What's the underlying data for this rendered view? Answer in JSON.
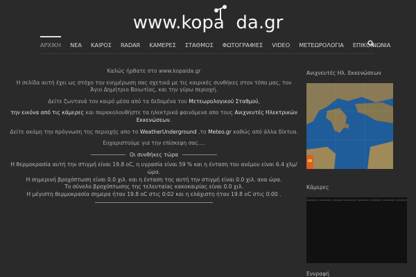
{
  "site": {
    "logo_text": "www.kopa  da.gr"
  },
  "nav": {
    "items": [
      {
        "label": "ΑΡΧΙΚΗ",
        "active": true
      },
      {
        "label": "ΝΕΑ"
      },
      {
        "label": "ΚΑΙΡΟΣ"
      },
      {
        "label": "RADAR"
      },
      {
        "label": "ΚΑΜΕΡΕΣ"
      },
      {
        "label": "ΣΤΑΘΜΟΣ"
      },
      {
        "label": "ΦΩΤΟΓΡΑΦΙΕΣ"
      },
      {
        "label": "VIDEO"
      },
      {
        "label": "ΜΕΤΕΩΡΟΛΟΓΙΑ"
      },
      {
        "label": "ΕΠΙΚΟΙΝΩΝΙΑ"
      }
    ]
  },
  "main": {
    "welcome": "Καλώς ήρθατε στο www.kopaida.gr",
    "intro": "Η σελίδα αυτή έχει ως στόχο την ενημέρωση σας σχετικά με τις καιρικές συνθήκες στον τόπο μας, τον Άγιο Δημήτριο Βοιωτίας, και την γύρω περιοχή.",
    "live_prefix": "Δείτε ζωντανά τον καιρό μέσα από τα δεδομένα του ",
    "live_link": "Μετεωρολογικού Σταθμού",
    "live_suffix": ",",
    "cams_link": "την εικόνα από τις κάμερες",
    "cams_mid": " και παρακολουθήστε τα ηλεκτρικά φαινόμενα απο τους ",
    "cams_link2": "Ανιχνευτές Ηλεκτρικών Εκκενώσεων",
    "cams_suffix": ".",
    "forecast_prefix": "Δείτε ακόμη την πρόγνωση της περιοχής απο το ",
    "forecast_link1": "WeatherUnderground",
    "forecast_mid": " ,το ",
    "forecast_link2": "Meteo.gr",
    "forecast_suffix": " καθώς από άλλα δίκτυα.",
    "thanks": "Ευχαριστούμε για την επίσκεψη σας....",
    "conditions_title": "Οι συνθήκες τώρα",
    "temp_line": "Η θερμοκρασία αυτή την στιγμή είναι 19.8 oC, η υγρασία είναι 59 % και η ένταση του ανέμου είναι 6.4 χλμ/ώρα.",
    "rain_line": "Η σημερινή βροχόπτωση είναι 0.0 χιλ. και η ένταση της αυτή την στιγμή είναι 0.0 χιλ. ανα ώρα.",
    "total_rain_line": "Το σύνολο βροχόπτωσης της τελευταίας κακοκαιρίας είναι 0.0 χιλ.",
    "maxmin_line": "Η μέγιστη θερμοκρασία σημερα ήταν 19.8 oC στις 0:02 και η ελάχιστη ήταν 19.8 oC στις 0:00 ."
  },
  "sidebar": {
    "lightning_title": "Ανιχνευτές Ηλ. Εκκενώσεων",
    "cameras_title": "Κάμερες",
    "login_title": "Εννραφή"
  },
  "colors": {
    "background": "#2a2a2a",
    "sea": "#1f5c9a",
    "land": "#8a7a55",
    "strike": "#e8561a"
  }
}
